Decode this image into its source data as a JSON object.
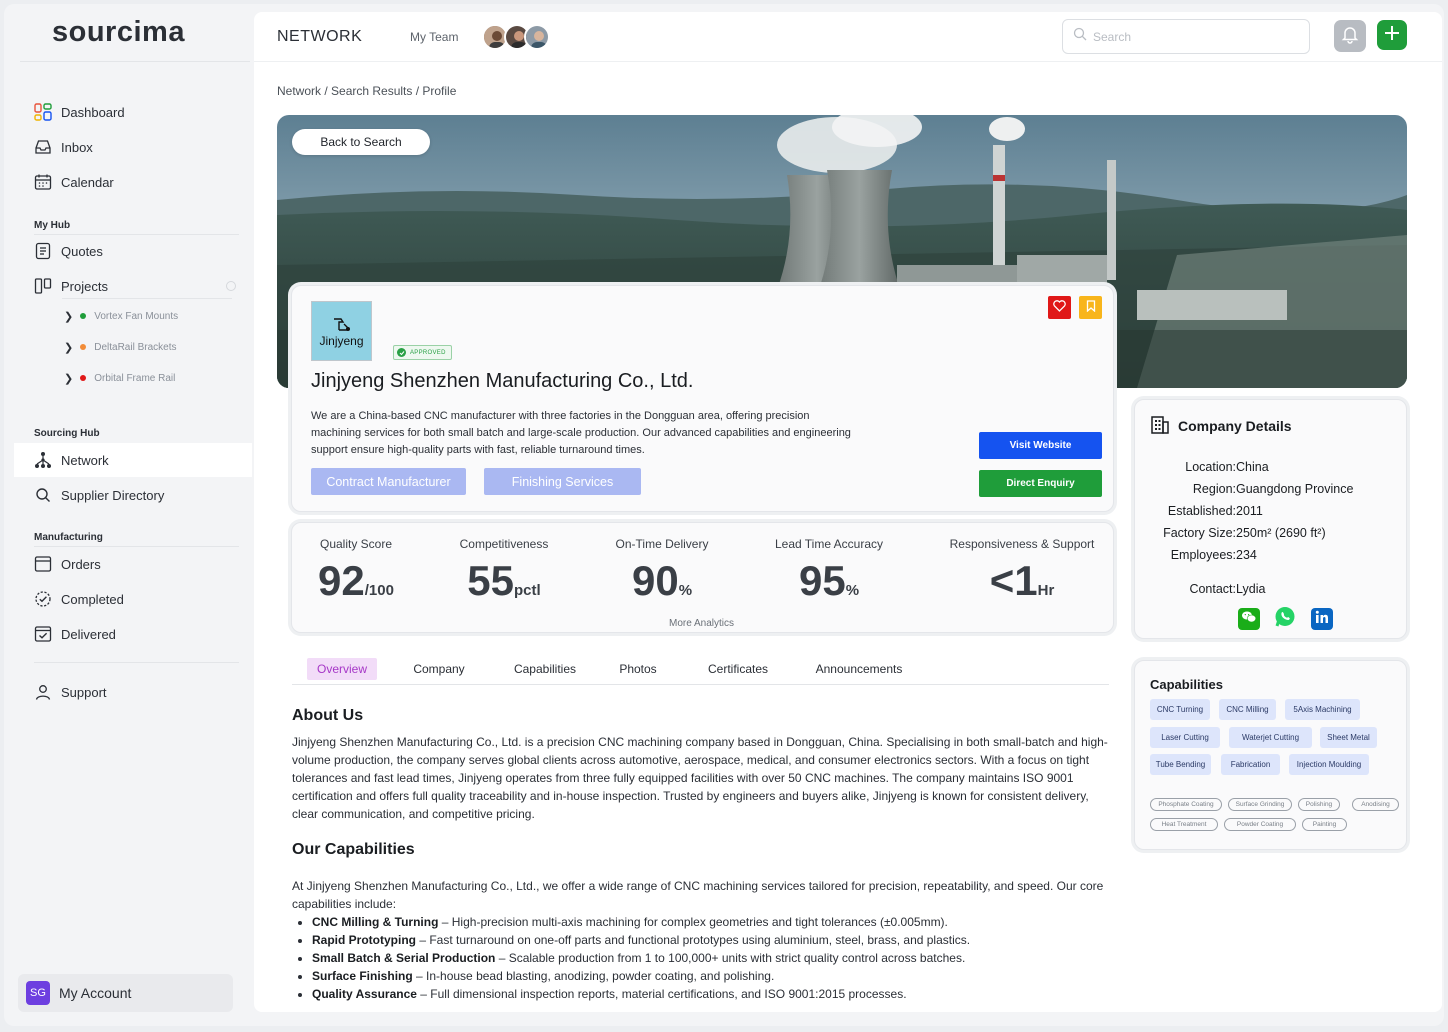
{
  "app": {
    "logo": "sourcima"
  },
  "sidebar": {
    "nav": [
      {
        "label": "Dashboard",
        "icon": "dashboard-icon"
      },
      {
        "label": "Inbox",
        "icon": "inbox-icon"
      },
      {
        "label": "Calendar",
        "icon": "calendar-icon"
      }
    ],
    "my_hub": {
      "title": "My Hub",
      "items": [
        {
          "label": "Quotes"
        },
        {
          "label": "Projects"
        }
      ],
      "projects": [
        {
          "label": "Vortex Fan Mounts",
          "color": "#1f9d3a"
        },
        {
          "label": "DeltaRail Brackets",
          "color": "#f28c38"
        },
        {
          "label": "Orbital Frame Rail",
          "color": "#e01818"
        }
      ]
    },
    "sourcing_hub": {
      "title": "Sourcing Hub",
      "items": [
        {
          "label": "Network"
        },
        {
          "label": "Supplier Directory"
        }
      ]
    },
    "manufacturing": {
      "title": "Manufacturing",
      "items": [
        {
          "label": "Orders"
        },
        {
          "label": "Completed"
        },
        {
          "label": "Delivered"
        }
      ]
    },
    "support": {
      "label": "Support"
    },
    "account": {
      "initials": "SG",
      "label": "My Account"
    }
  },
  "topbar": {
    "title": "NETWORK",
    "team_label": "My Team",
    "search_placeholder": "Search"
  },
  "breadcrumb": "Network / Search Results / Profile",
  "hero": {
    "back_label": "Back to Search"
  },
  "profile": {
    "logo_text": "Jinjyeng",
    "badge": "APPROVED",
    "name": "Jinjyeng Shenzhen Manufacturing Co., Ltd.",
    "description": "We are a China-based CNC manufacturer with three factories in the Dongguan area, offering precision machining services for both small batch and large-scale production. Our advanced capabilities and engineering support ensure high-quality parts with fast, reliable turnaround times.",
    "tags": [
      "Contract Manufacturer",
      "Finishing Services"
    ],
    "visit_label": "Visit Website",
    "enquiry_label": "Direct Enquiry"
  },
  "stats": {
    "items": [
      {
        "label": "Quality Score",
        "value": "92",
        "unit": "/100"
      },
      {
        "label": "Competitiveness",
        "value": "55",
        "unit": "pctl"
      },
      {
        "label": "On-Time Delivery",
        "value": "90",
        "unit": "%"
      },
      {
        "label": "Lead Time Accuracy",
        "value": "95",
        "unit": "%"
      },
      {
        "label": "Responsiveness & Support",
        "value": "<1",
        "unit": "Hr"
      }
    ],
    "more_label": "More Analytics"
  },
  "tabs": [
    "Overview",
    "Company",
    "Capabilities",
    "Photos",
    "Certificates",
    "Announcements"
  ],
  "about": {
    "title": "About Us",
    "text": "Jinjyeng Shenzhen Manufacturing Co., Ltd. is a precision CNC machining company based in Dongguan, China. Specialising in both small-batch and high-volume production, the company serves global clients across automotive, aerospace, medical, and consumer electronics sectors. With a focus on tight tolerances and fast lead times, Jinjyeng operates from three fully equipped facilities with over 50 CNC machines. The company maintains ISO 9001 certification and offers full quality traceability and in-house inspection. Trusted by engineers and buyers alike, Jinjyeng is known for consistent delivery, clear communication, and competitive pricing."
  },
  "our_capabilities": {
    "title": "Our Capabilities",
    "intro": "At Jinjyeng Shenzhen Manufacturing Co., Ltd., we offer a wide range of CNC machining services tailored for precision, repeatability, and speed. Our core capabilities include:",
    "items": [
      {
        "term": "CNC Milling & Turning",
        "desc": " – High-precision multi-axis machining for complex geometries and tight tolerances (±0.005mm)."
      },
      {
        "term": "Rapid Prototyping",
        "desc": " – Fast turnaround on one-off parts and functional prototypes using aluminium, steel, brass, and plastics."
      },
      {
        "term": "Small Batch & Serial Production",
        "desc": " – Scalable production from 1 to 100,000+ units with strict quality control across batches."
      },
      {
        "term": "Surface Finishing",
        "desc": " – In-house bead blasting, anodizing, powder coating, and polishing."
      },
      {
        "term": "Quality Assurance",
        "desc": " – Full dimensional inspection reports, material certifications, and ISO 9001:2015 processes."
      }
    ]
  },
  "company_details": {
    "title": "Company Details",
    "rows": [
      {
        "key": "Location:",
        "value": "China"
      },
      {
        "key": "Region:",
        "value": "Guangdong Province"
      },
      {
        "key": "Established:",
        "value": "2011"
      },
      {
        "key": "Factory Size:",
        "value": "250m² (2690 ft²)"
      },
      {
        "key": "Employees:",
        "value": "234"
      }
    ],
    "contact_key": "Contact:",
    "contact_value": "Lydia"
  },
  "capabilities": {
    "title": "Capabilities",
    "primary": [
      "CNC Turning",
      "CNC Milling",
      "5Axis Machining",
      "Laser Cutting",
      "Waterjet Cutting",
      "Sheet Metal",
      "Tube Bending",
      "Fabrication",
      "Injection Moulding"
    ],
    "secondary": [
      "Phosphate Coating",
      "Surface Grinding",
      "Polishing",
      "Anodising",
      "Heat Treatment",
      "Powder Coating",
      "Painting"
    ]
  },
  "colors": {
    "accent_blue": "#1553f0",
    "accent_green": "#1f9d3a",
    "tab_active": "#a637c7"
  }
}
